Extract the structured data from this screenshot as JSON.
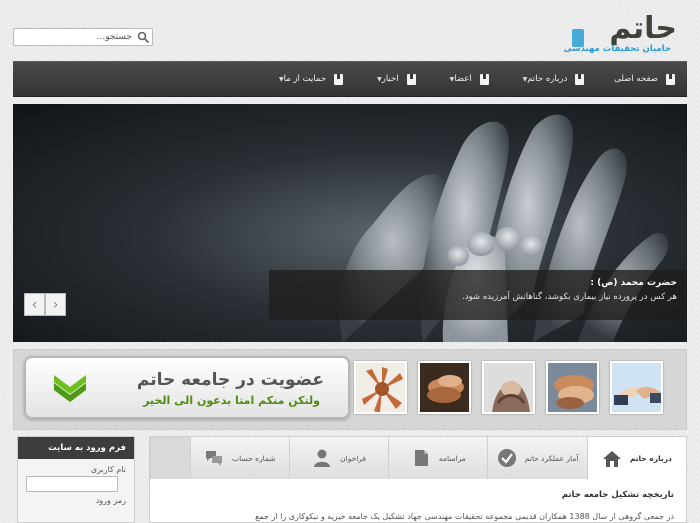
{
  "header": {
    "search_placeholder": "جستجو...",
    "logo_title": "حاتم",
    "logo_subtitle": "حامیان تحقیقات مهندسی"
  },
  "nav": {
    "items": [
      {
        "label": "صفحه اصلی",
        "has_dropdown": false
      },
      {
        "label": "درباره حاتم",
        "has_dropdown": true
      },
      {
        "label": "اعضا",
        "has_dropdown": true
      },
      {
        "label": "اخبار",
        "has_dropdown": true
      },
      {
        "label": "حمایت از ما",
        "has_dropdown": true
      }
    ]
  },
  "slider": {
    "caption_title": "حضرت محمد (ص) :",
    "caption_text": "هر کس در پرورده نیاز بیماری بکوشد، گناهانش آمرزیده شود.",
    "prev": "‹",
    "next": "›"
  },
  "membership": {
    "heading": "عضویت در جامعه حاتم",
    "subheading": "ولتکن منکم امتا یدعون الی الخیر"
  },
  "login_form": {
    "title": "فرم ورود به سایت",
    "username_label": "نام کاربری",
    "password_label": "رمز ورود"
  },
  "tabs": {
    "items": [
      {
        "label": "درباره حاتم",
        "icon": "home-icon",
        "active": true
      },
      {
        "label": "آمار عملکرد حاتم",
        "icon": "check-circle-icon",
        "active": false
      },
      {
        "label": "مرامنامه",
        "icon": "document-icon",
        "active": false
      },
      {
        "label": "فراخوان",
        "icon": "user-icon",
        "active": false
      },
      {
        "label": "شماره حساب",
        "icon": "chat-bubbles-icon",
        "active": false
      }
    ],
    "content_title": "تاریخچه تشکیل جامعه حاتم",
    "content_text": "در جمعی گروهی از سال 1388 همکاران قدیمی مجموعه تحقیقات مهندسی جهاد تشکیل یک جامعه خیریه و نیکوکاری را از جمع"
  },
  "colors": {
    "nav_bg": "#3a3a3a",
    "accent_blue": "#2a9ad4",
    "accent_green": "#4e8b0e"
  }
}
